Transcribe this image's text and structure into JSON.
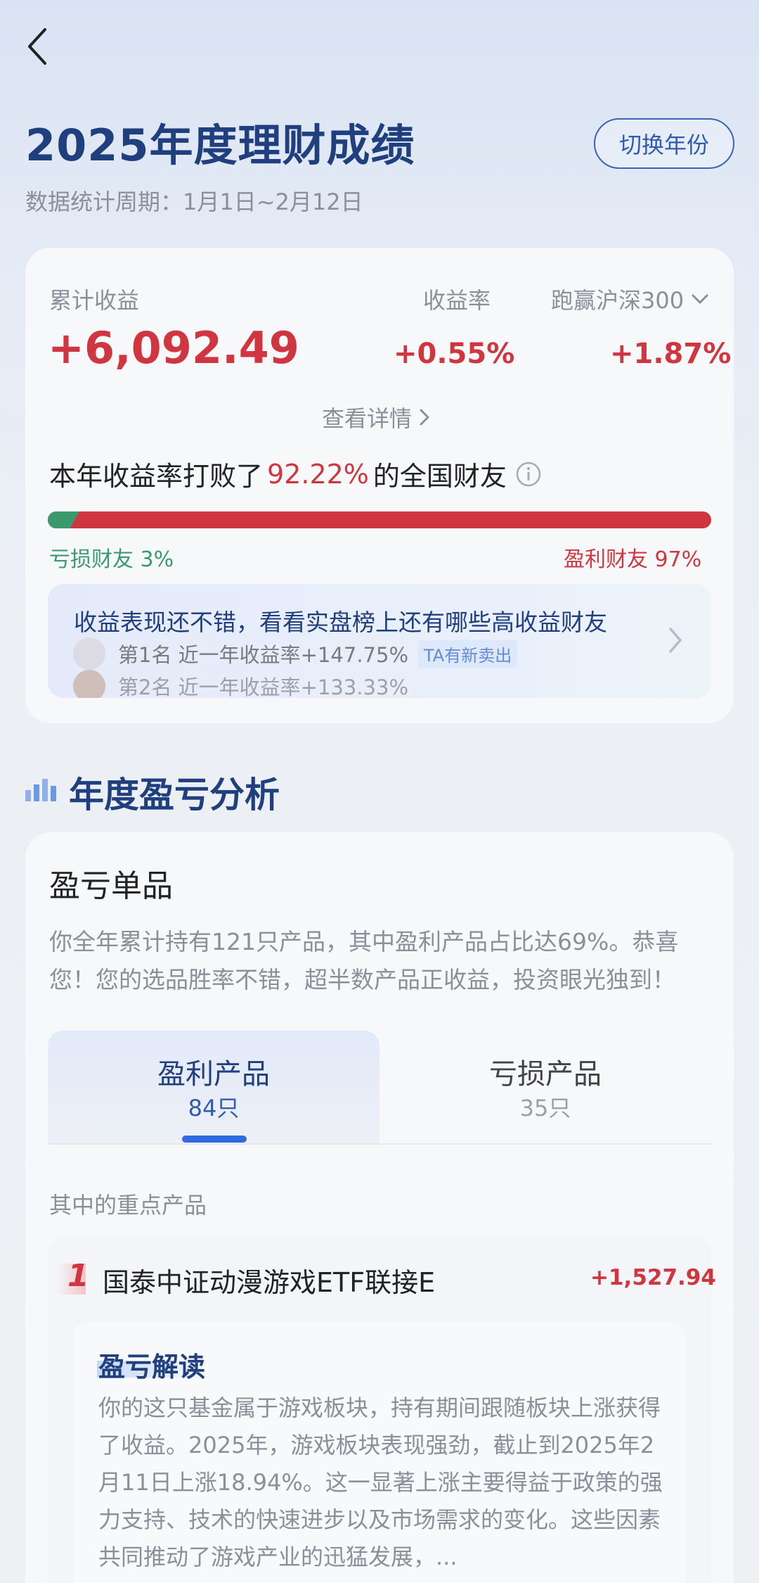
{
  "header": {
    "title": "2025年度理财成绩",
    "period": "数据统计周期：1月1日~2月12日",
    "switch_year": "切换年份"
  },
  "summary": {
    "cumulative_label": "累计收益",
    "cumulative_value": "+6,092.49",
    "rate_label": "收益率",
    "rate_value": "+0.55%",
    "benchmark_label": "跑赢沪深300",
    "benchmark_value": "+1.87%",
    "details_link": "查看详情",
    "beat_prefix": "本年收益率打败了",
    "beat_percent": "92.22%",
    "beat_suffix": "的全国财友",
    "loss_label": "亏损财友 3%",
    "profit_label": "盈利财友 97%",
    "loss_fraction": 0.03,
    "colors": {
      "profit": "#d0363f",
      "loss": "#3a9a6e"
    }
  },
  "promo": {
    "title": "收益表现还不错，看看实盘榜上还有哪些高收益财友",
    "row1": "第1名 近一年收益率+147.75%",
    "row1_tag": "TA有新卖出",
    "row2": "第2名 近一年收益率+133.33%"
  },
  "analysis_section": {
    "title": "年度盈亏分析",
    "card_title": "盈亏单品",
    "description": "你全年累计持有121只产品，其中盈利产品占比达69%。恭喜您！您的选品胜率不错，超半数产品正收益，投资眼光独到！",
    "tabs": [
      {
        "label": "盈利产品",
        "count": "84只"
      },
      {
        "label": "亏损产品",
        "count": "35只"
      }
    ],
    "key_products_label": "其中的重点产品",
    "product": {
      "rank": "1",
      "name": "国泰中证动漫游戏ETF联接E",
      "value": "+1,527.94",
      "interpretation_title": "盈亏解读",
      "interpretation_text": "你的这只基金属于游戏板块，持有期间跟随板块上涨获得了收益。2025年，游戏板块表现强劲，截止到2025年2月11日上涨18.94%。这一显著上涨主要得益于政策的强力支持、技术的快速进步以及市场需求的变化。这些因素共同推动了游戏产业的迅猛发展，..."
    }
  }
}
